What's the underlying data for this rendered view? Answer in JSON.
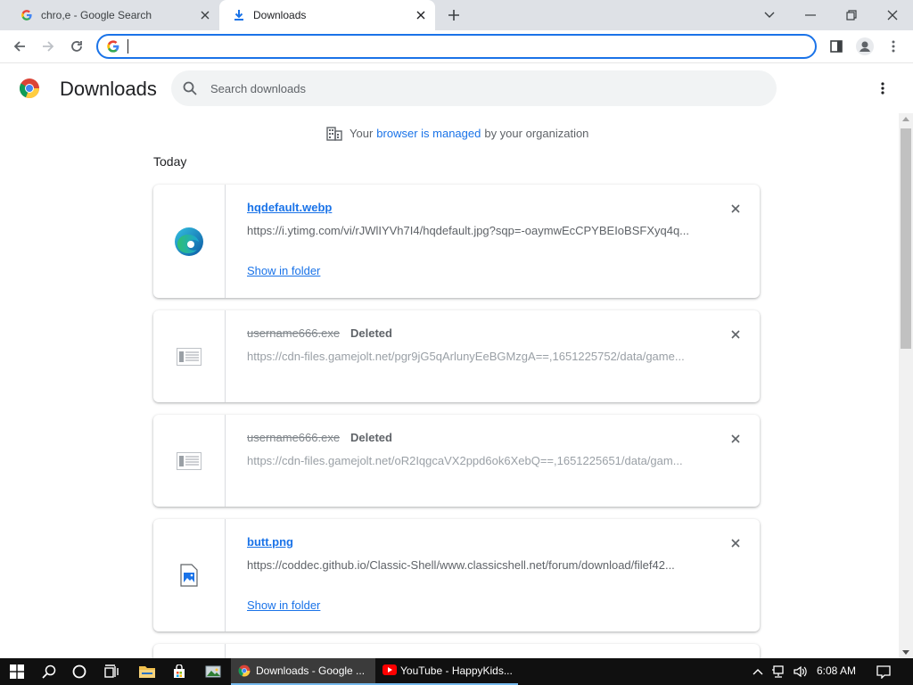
{
  "tabs": [
    {
      "title": "chro,e - Google Search",
      "favicon": "google-icon"
    },
    {
      "title": "Downloads",
      "favicon": "download-icon",
      "active": true
    }
  ],
  "omnibox": {
    "value": "",
    "placeholder": ""
  },
  "header": {
    "title": "Downloads",
    "search_placeholder": "Search downloads"
  },
  "managed_notice": {
    "prefix": "Your",
    "link": "browser is managed",
    "suffix": "by your organization"
  },
  "date_group": "Today",
  "downloads": [
    {
      "filename": "hqdefault.webp",
      "url": "https://i.ytimg.com/vi/rJWlIYVh7I4/hqdefault.jpg?sqp=-oaymwEcCPYBEIoBSFXyq4q...",
      "action": "Show in folder",
      "icon": "edge-icon"
    },
    {
      "filename": "username666.exe",
      "status": "Deleted",
      "url": "https://cdn-files.gamejolt.net/pgr9jG5qArlunyEeBGMzgA==,1651225752/data/game...",
      "icon": "file-generic-icon"
    },
    {
      "filename": "username666.exe",
      "status": "Deleted",
      "url": "https://cdn-files.gamejolt.net/oR2IqgcaVX2ppd6ok6XebQ==,1651225651/data/gam...",
      "icon": "file-generic-icon"
    },
    {
      "filename": "butt.png",
      "url": "https://coddec.github.io/Classic-Shell/www.classicshell.net/forum/download/filef42...",
      "action": "Show in folder",
      "icon": "image-file-icon"
    }
  ],
  "taskbar": {
    "apps": [
      {
        "label": "Downloads - Google ...",
        "icon": "chrome-icon"
      },
      {
        "label": "YouTube - HappyKids...",
        "icon": "youtube-icon"
      }
    ],
    "clock": "6:08 AM"
  },
  "colors": {
    "accent": "#1a73e8",
    "tabstrip": "#dee1e6",
    "taskbar": "#101010"
  }
}
